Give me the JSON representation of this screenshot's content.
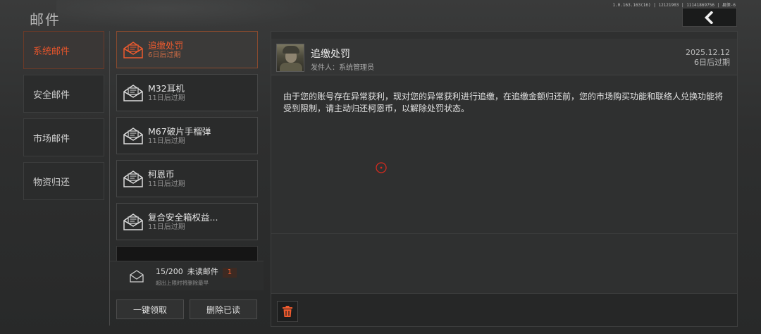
{
  "header": {
    "title": "邮件",
    "build_info": "1.0.163.163(16) | 12121903 | 11141869756 | 县保-6"
  },
  "categories": [
    {
      "label": "系统邮件",
      "active": true
    },
    {
      "label": "安全邮件",
      "active": false
    },
    {
      "label": "市场邮件",
      "active": false
    },
    {
      "label": "物资归还",
      "active": false
    }
  ],
  "mails": [
    {
      "title": "追缴处罚",
      "expire": "6日后过期",
      "active": true
    },
    {
      "title": "M32耳机",
      "expire": "11日后过期",
      "active": false
    },
    {
      "title": "M67破片手榴弹",
      "expire": "11日后过期",
      "active": false
    },
    {
      "title": "柯恩币",
      "expire": "11日后过期",
      "active": false
    },
    {
      "title": "复合安全箱权益...",
      "expire": "11日后过期",
      "active": false
    }
  ],
  "footer": {
    "count": "15/200",
    "unread_label": "未读邮件",
    "unread_count": "1",
    "hint": "超出上限时将删除最早",
    "claim_all": "一键领取",
    "delete_read": "删除已读"
  },
  "detail": {
    "title": "追缴处罚",
    "sender": "发件人：系统管理员",
    "date": "2025.12.12",
    "expire": "6日后过期",
    "body": "由于您的账号存在异常获利，现对您的异常获利进行追缴，在追缴金额归还前，您的市场购买功能和联络人兑换功能将受到限制，请主动归还柯恩币，以解除处罚状态。"
  },
  "colors": {
    "accent": "#f05b2e",
    "background": "#2e2f2f",
    "panel": "#2f3030"
  },
  "icons": {
    "back": "chevron-left-icon",
    "mail": "open-envelope-icon",
    "delete": "trash-icon",
    "cursor": "crosshair-icon"
  }
}
